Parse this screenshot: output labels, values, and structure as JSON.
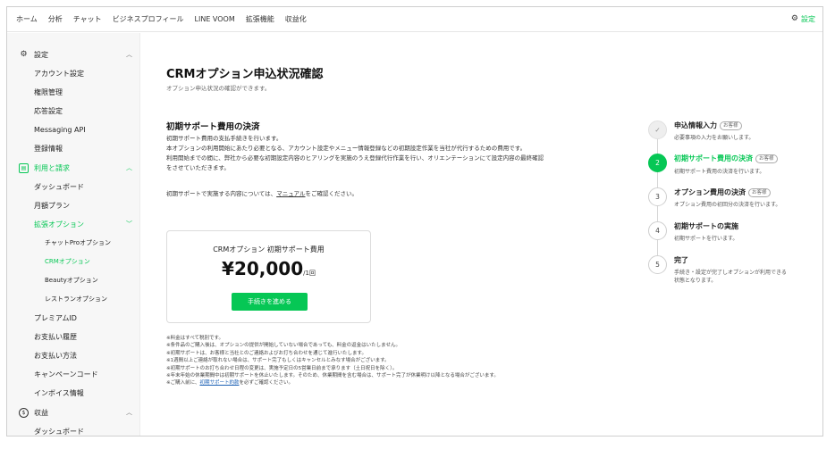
{
  "topnav": {
    "items": [
      "ホーム",
      "分析",
      "チャット",
      "ビジネスプロフィール",
      "LINE VOOM",
      "拡張機能",
      "収益化"
    ],
    "settings_label": "設定"
  },
  "sidebar": {
    "settings_section": "設定",
    "settings_items": [
      "アカウント設定",
      "権限管理",
      "応答設定",
      "Messaging API",
      "登録情報"
    ],
    "billing_section": "利用と請求",
    "billing_items": {
      "dashboard": "ダッシュボード",
      "monthly_plan": "月額プラン",
      "extension_options": "拡張オプション",
      "options": [
        "チャットProオプション",
        "CRMオプション",
        "Beautyオプション",
        "レストランオプション"
      ],
      "rest": [
        "プレミアムID",
        "お支払い履歴",
        "お支払い方法",
        "キャンペーンコード",
        "インボイス情報"
      ]
    },
    "revenue_section": "収益",
    "revenue_items": [
      "ダッシュボード"
    ]
  },
  "main": {
    "title": "CRMオプション申込状況確認",
    "subtitle": "オプション申込状況の確認ができます。",
    "section_title": "初期サポート費用の決済",
    "description": [
      "初期サポート費用の支払手続きを行います。",
      "本オプションの利用開始にあたり必要となる、アカウント設定やメニュー情報登録などの初期設定作業を当社が代行するための費用です。",
      "利用開始までの間に、弊社から必要な初期設定内容のヒアリングを実施のうえ登録代行作業を行い、オリエンテーションにて設定内容の最終確認",
      "をさせていただきます。"
    ],
    "reference_prefix": "初期サポートで実施する内容については、",
    "reference_link": "マニュアル",
    "reference_suffix": "をご確認ください。",
    "card": {
      "title": "CRMオプション 初期サポート費用",
      "price": "¥20,000",
      "unit": "/1回",
      "button": "手続きを進める"
    },
    "notes": [
      "※料金はすべて税別です。",
      "※条件品のご購入後は、オプションの提供が開始していない場合であっても、料金の返金はいたしません。",
      "※初期サポートは、お客様と当社とのご連絡およびお打ち合わせを通じて進行いたします。",
      "※1週間以上ご連絡が取れない場合は、サポート完了もしくはキャンセルとみなす場合がございます。",
      "※初期サポートのお打ち合わせ日程の変更は、実施予定日の5営業日前まで承ります（土日祝日を除く）。",
      "※年末年始の休業期間中は初期サポートを休止いたします。そのため、休業期間を含む場合は、サポート完了が休業明け以降となる場合がございます。"
    ],
    "last_note_prefix": "※ご購入前に、",
    "last_note_link": "初期サポート約款",
    "last_note_suffix": "を必ずご確認ください。"
  },
  "stepper": {
    "steps": [
      {
        "number": "✓",
        "title": "申込情報入力",
        "badge": "お客様",
        "desc": [
          "必要事項の入力をお願いします。"
        ]
      },
      {
        "number": "2",
        "title": "初期サポート費用の決済",
        "badge": "お客様",
        "desc": [
          "初期サポート費用の決済を行います。"
        ]
      },
      {
        "number": "3",
        "title": "オプション費用の決済",
        "badge": "お客様",
        "desc": [
          "オプション費用の初回分の決済を行います。"
        ]
      },
      {
        "number": "4",
        "title": "初期サポートの実施",
        "badge": "",
        "desc": [
          "初期サポートを行います。"
        ]
      },
      {
        "number": "5",
        "title": "完了",
        "badge": "",
        "desc": [
          "手続き・設定が完了しオプションが利用できる",
          "状態となります。"
        ]
      }
    ]
  },
  "colors": {
    "accent": "#06c755",
    "text": "#222222",
    "sidebar_bg": "#f7f7f7"
  }
}
